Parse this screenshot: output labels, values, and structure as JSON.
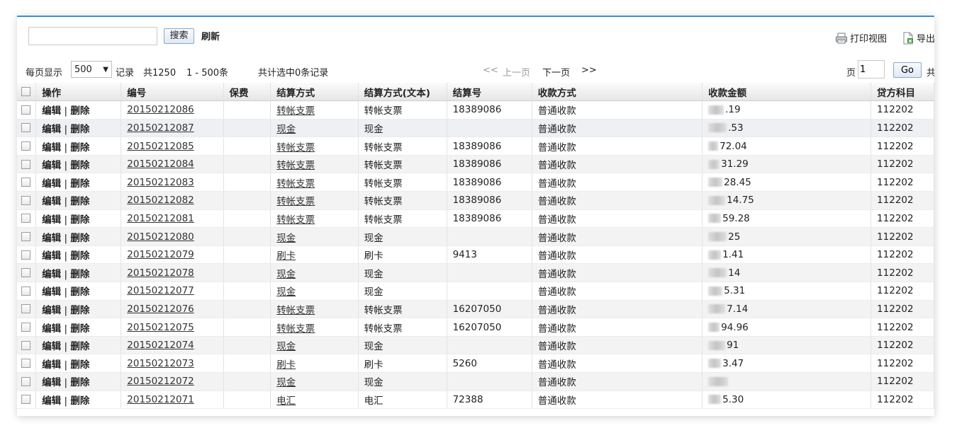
{
  "toolbar": {
    "search_value": "",
    "search_label": "搜索",
    "refresh_label": "刷新",
    "print_view_label": "打印视图",
    "export_label": "导出"
  },
  "pager": {
    "per_page_label": "每页显示",
    "per_page_value": "500",
    "records_label": "记录",
    "total_text": "共1250",
    "range_text": "1 - 500条",
    "selected_text": "共计选中0条记录",
    "first_label": "<<",
    "prev_label": "上一页",
    "next_label": "下一页",
    "last_label": ">>",
    "page_label": "页",
    "page_value": "1",
    "go_label": "Go",
    "total_pages_prefix": "共"
  },
  "table": {
    "columns": [
      "操作",
      "编号",
      "保费",
      "结算方式",
      "结算方式(文本)",
      "结算号",
      "收款方式",
      "收款金额",
      "贷方科目"
    ],
    "edit_label": "编辑",
    "separator": " | ",
    "delete_label": "删除",
    "rows": [
      {
        "id": "20150212086",
        "fee": "",
        "method": "转帐支票",
        "method_text": "转帐支票",
        "no": "18389086",
        "pay": "普通收款",
        "amount": ".19",
        "credit": "112202"
      },
      {
        "id": "20150212087",
        "fee": "",
        "method": "现金",
        "method_text": "现金",
        "no": "",
        "pay": "普通收款",
        "amount": ".53",
        "credit": "112202"
      },
      {
        "id": "20150212085",
        "fee": "",
        "method": "转帐支票",
        "method_text": "转帐支票",
        "no": "18389086",
        "pay": "普通收款",
        "amount": "72.04",
        "credit": "112202"
      },
      {
        "id": "20150212084",
        "fee": "",
        "method": "转帐支票",
        "method_text": "转帐支票",
        "no": "18389086",
        "pay": "普通收款",
        "amount": "31.29",
        "credit": "112202"
      },
      {
        "id": "20150212083",
        "fee": "",
        "method": "转帐支票",
        "method_text": "转帐支票",
        "no": "18389086",
        "pay": "普通收款",
        "amount": "28.45",
        "credit": "112202"
      },
      {
        "id": "20150212082",
        "fee": "",
        "method": "转帐支票",
        "method_text": "转帐支票",
        "no": "18389086",
        "pay": "普通收款",
        "amount": "14.75",
        "credit": "112202"
      },
      {
        "id": "20150212081",
        "fee": "",
        "method": "转帐支票",
        "method_text": "转帐支票",
        "no": "18389086",
        "pay": "普通收款",
        "amount": "59.28",
        "credit": "112202"
      },
      {
        "id": "20150212080",
        "fee": "",
        "method": "现金",
        "method_text": "现金",
        "no": "",
        "pay": "普通收款",
        "amount": "25",
        "credit": "112202"
      },
      {
        "id": "20150212079",
        "fee": "",
        "method": "刷卡",
        "method_text": "刷卡",
        "no": "9413",
        "pay": "普通收款",
        "amount": "1.41",
        "credit": "112202"
      },
      {
        "id": "20150212078",
        "fee": "",
        "method": "现金",
        "method_text": "现金",
        "no": "",
        "pay": "普通收款",
        "amount": "14",
        "credit": "112202"
      },
      {
        "id": "20150212077",
        "fee": "",
        "method": "现金",
        "method_text": "现金",
        "no": "",
        "pay": "普通收款",
        "amount": "5.31",
        "credit": "112202"
      },
      {
        "id": "20150212076",
        "fee": "",
        "method": "转帐支票",
        "method_text": "转帐支票",
        "no": "16207050",
        "pay": "普通收款",
        "amount": "7.14",
        "credit": "112202"
      },
      {
        "id": "20150212075",
        "fee": "",
        "method": "转帐支票",
        "method_text": "转帐支票",
        "no": "16207050",
        "pay": "普通收款",
        "amount": "94.96",
        "credit": "112202"
      },
      {
        "id": "20150212074",
        "fee": "",
        "method": "现金",
        "method_text": "现金",
        "no": "",
        "pay": "普通收款",
        "amount": "91",
        "credit": "112202"
      },
      {
        "id": "20150212073",
        "fee": "",
        "method": "刷卡",
        "method_text": "刷卡",
        "no": "5260",
        "pay": "普通收款",
        "amount": "3.47",
        "credit": "112202"
      },
      {
        "id": "20150212072",
        "fee": "",
        "method": "现金",
        "method_text": "现金",
        "no": "",
        "pay": "普通收款",
        "amount": "",
        "credit": "112202"
      },
      {
        "id": "20150212071",
        "fee": "",
        "method": "电汇",
        "method_text": "电汇",
        "no": "72388",
        "pay": "普通收款",
        "amount": "5.30",
        "credit": "112202"
      }
    ]
  },
  "colors": {
    "accent_border": "#3a8fd6",
    "row_alt": "#f3f3f3"
  }
}
